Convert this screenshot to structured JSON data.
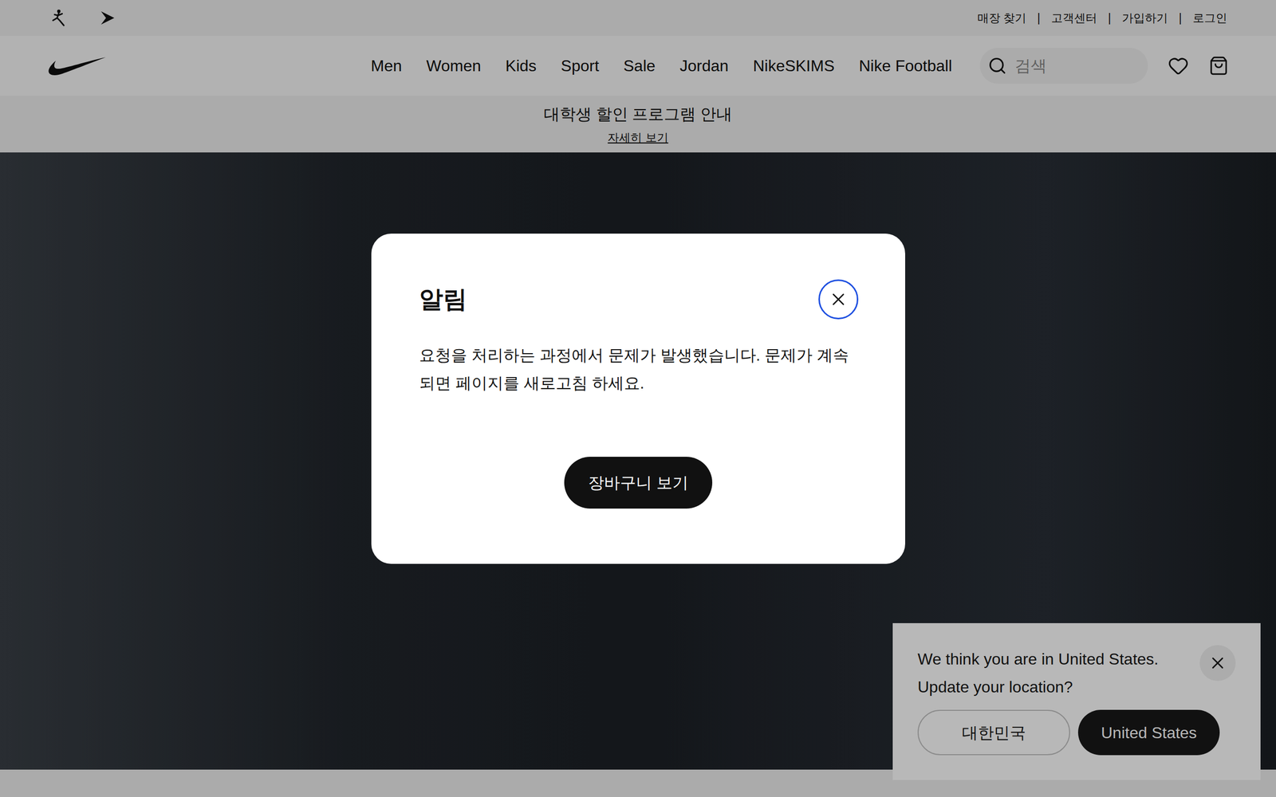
{
  "topbar": {
    "links": [
      "매장 찾기",
      "고객센터",
      "가입하기",
      "로그인"
    ],
    "separator": "|"
  },
  "nav": {
    "items": [
      "Men",
      "Women",
      "Kids",
      "Sport",
      "Sale",
      "Jordan",
      "NikeSKIMS",
      "Nike Football"
    ]
  },
  "search": {
    "placeholder": "검색"
  },
  "banner": {
    "title": "대학생 할인 프로그램 안내",
    "link": "자세히 보기"
  },
  "modal": {
    "title": "알림",
    "message": "요청을 처리하는 과정에서 문제가 발생했습니다. 문제가 계속되면 페이지를 새로고침 하세요.",
    "button": "장바구니 보기"
  },
  "location_prompt": {
    "message": "We think you are in United States. Update your location?",
    "buttons": [
      {
        "label": "대한민국",
        "selected": false
      },
      {
        "label": "United States",
        "selected": true
      }
    ]
  }
}
